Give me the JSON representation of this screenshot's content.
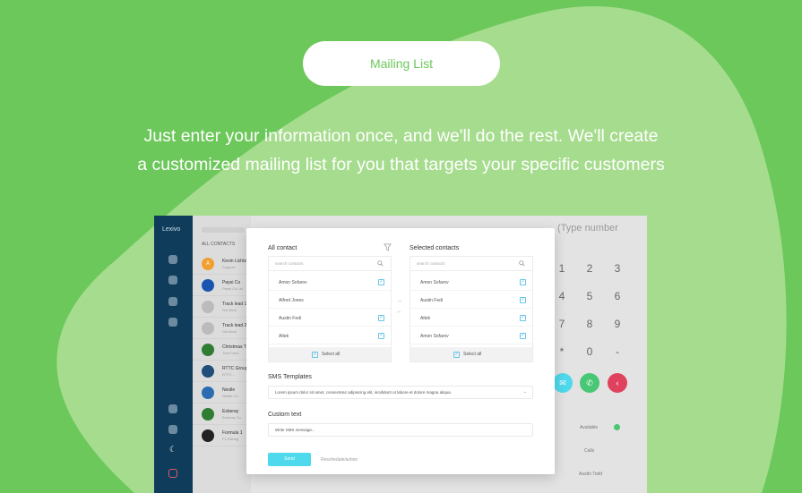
{
  "pill_label": "Mailing List",
  "headline": {
    "line1": "Just enter your information once, and we'll do the rest. We'll create",
    "line2": "a customized mailing list for you that targets your specific customers"
  },
  "colors": {
    "background": "#6cc85a",
    "blob": "#a6dc8e",
    "accent": "#4fd9ec",
    "sidebar": "#0f3c5a"
  },
  "app": {
    "logo": "Lexivo",
    "contacts_heading": "ALL CONTACTS",
    "contacts": [
      {
        "name": "Kevin Lichts",
        "sub": "Support...",
        "avatar": "A"
      },
      {
        "name": "Pepsi Co",
        "sub": "Pepsi Co Ltd",
        "avatar": ""
      },
      {
        "name": "Track lead 1",
        "sub": "Gut Beat",
        "avatar": ""
      },
      {
        "name": "Track lead 2",
        "sub": "Gut Beat",
        "avatar": ""
      },
      {
        "name": "Christmas Tree",
        "sub": "Tree Farm",
        "avatar": ""
      },
      {
        "name": "RTTC Group",
        "sub": "RTTC...",
        "avatar": ""
      },
      {
        "name": "Nestle",
        "sub": "Nestle Co",
        "avatar": ""
      },
      {
        "name": "Esberay",
        "sub": "Esberay Co",
        "avatar": ""
      },
      {
        "name": "Formula 1",
        "sub": "F1 Racing",
        "avatar": ""
      }
    ],
    "dial_placeholder": "(Type number",
    "keypad": [
      "1",
      "2",
      "3",
      "4",
      "5",
      "6",
      "7",
      "8",
      "9",
      "*",
      "0",
      "-"
    ],
    "table": {
      "available": "Available",
      "calls": "Calls",
      "austin": "Austin Todd"
    }
  },
  "modal": {
    "all_contacts_title": "All contact",
    "selected_title": "Selected contacts",
    "search_placeholder": "search contacts",
    "all_list": [
      "Amon Sofarov",
      "Alfred Jones",
      "Austin Fedi",
      "Altek"
    ],
    "selected_list": [
      "Amon Sofarov",
      "Austin Fedi",
      "Altek",
      "Amon Sofarov"
    ],
    "select_all": "Select all",
    "sms_templates_label": "SMS Templates",
    "sms_template_value": "Lorem ipsum dolor sit amet, consectetur adipiscing elit, incididunt ut labore et dolore magna aliqua.",
    "custom_text_label": "Custom text",
    "custom_text_placeholder": "Write SMS message...",
    "send_label": "Send",
    "reschedule_label": "Reschedule/action"
  }
}
